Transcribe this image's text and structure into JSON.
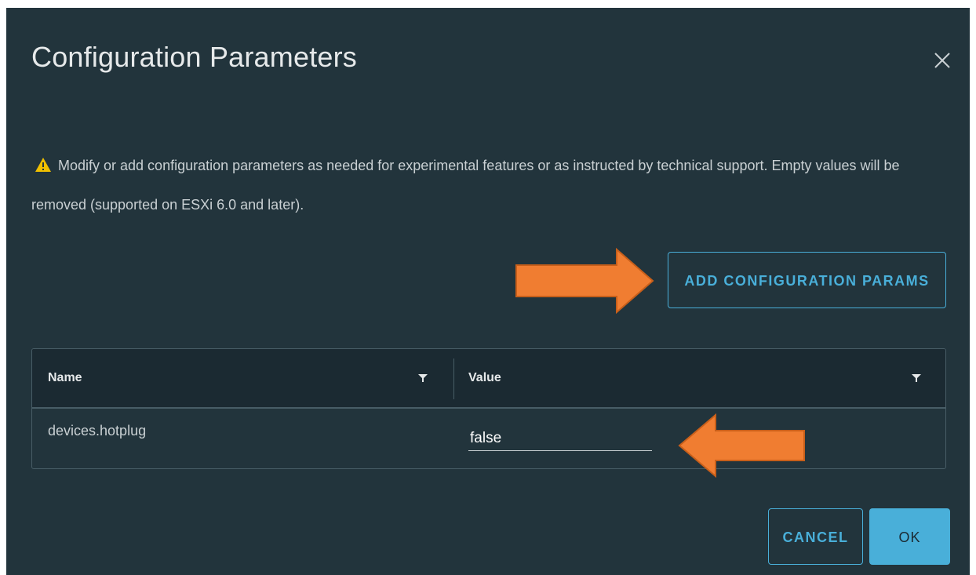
{
  "dialog": {
    "title": "Configuration Parameters",
    "close_icon": "close-icon",
    "message": "Modify or add configuration parameters as needed for experimental features or as instructed by technical support. Empty values will be removed (supported on ESXi 6.0 and later).",
    "warning_icon": "warning-icon"
  },
  "toolbar": {
    "add_label": "ADD CONFIGURATION PARAMS"
  },
  "grid": {
    "columns": [
      {
        "label": "Name",
        "filter_icon": "filter-icon"
      },
      {
        "label": "Value",
        "filter_icon": "filter-icon"
      }
    ],
    "rows": [
      {
        "name": "devices.hotplug",
        "value": "false"
      }
    ]
  },
  "footer": {
    "cancel_label": "CANCEL",
    "ok_label": "OK"
  },
  "colors": {
    "background": "#22343c",
    "header_background": "#1b2a32",
    "accent": "#49afd9",
    "warning": "#f0c000",
    "annotation_arrow": "#f07d31"
  }
}
